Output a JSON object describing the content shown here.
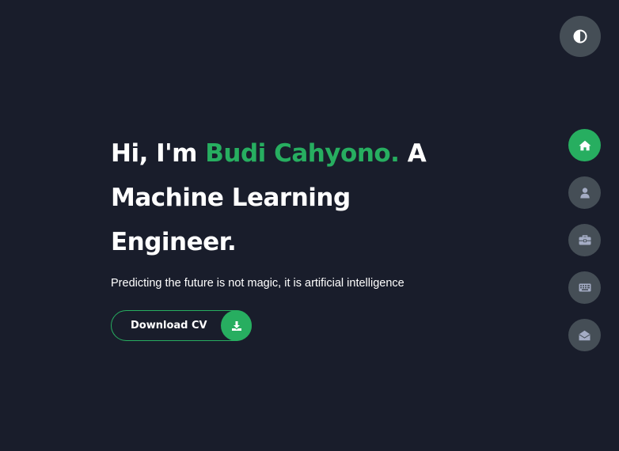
{
  "hero": {
    "greeting": "Hi, I'm ",
    "name": "Budi Cahyono.",
    "role_line_1": " A",
    "role_line_2": "Machine Learning",
    "role_line_3": "Engineer.",
    "subtitle": "Predicting the future is not magic, it is artificial intelligence"
  },
  "cv_button": {
    "label": "Download CV",
    "icon": "download-icon"
  },
  "theme_toggle": {
    "icon": "half-circle-contrast-icon"
  },
  "nav": {
    "items": [
      {
        "icon": "home-icon",
        "active": true
      },
      {
        "icon": "user-icon",
        "active": false
      },
      {
        "icon": "briefcase-icon",
        "active": false
      },
      {
        "icon": "keyboard-icon",
        "active": false
      },
      {
        "icon": "envelope-open-icon",
        "active": false
      }
    ]
  },
  "colors": {
    "background": "#191d2b",
    "accent": "#27ae60",
    "button_gray": "#454e56",
    "text": "#ffffff",
    "icon_gray": "#a4acc4"
  }
}
